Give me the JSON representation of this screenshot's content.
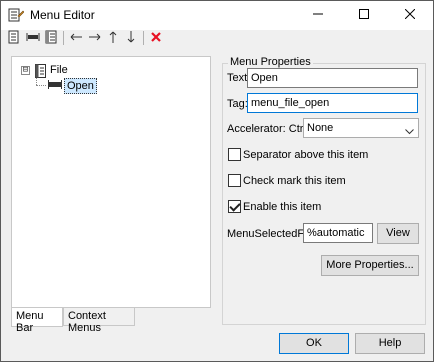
{
  "window": {
    "title": "Menu Editor"
  },
  "toolbar": {
    "icons": [
      "new-menu-icon",
      "new-menu-item-icon",
      "new-context-menu-icon",
      "move-left-icon",
      "move-right-icon",
      "move-up-icon",
      "move-down-icon",
      "delete-icon"
    ],
    "delete_color": "#e81123"
  },
  "tree": {
    "expander": "⊟",
    "items": [
      {
        "label": "File"
      },
      {
        "label": "Open"
      }
    ]
  },
  "tabs": [
    {
      "label": "Menu Bar"
    },
    {
      "label": "Context Menus"
    }
  ],
  "properties": {
    "title": "Menu Properties",
    "text_label": "Text:",
    "text_value": "Open",
    "tag_label": "Tag:",
    "tag_value": "menu_file_open",
    "accelerator_label": "Accelerator: Ctrl +",
    "accelerator_value": "None",
    "separator_label": "Separator above this item",
    "separator_checked": false,
    "checkmark_label": "Check mark this item",
    "checkmark_checked": false,
    "enable_label": "Enable this item",
    "enable_checked": true,
    "callback_label": "MenuSelectedFcn:",
    "callback_value": "%automatic",
    "view_button": "View",
    "more_button": "More Properties..."
  },
  "footer": {
    "ok_button": "OK",
    "help_button": "Help"
  },
  "colors": {
    "selection": "#cde8ff",
    "focus_border": "#0078d7"
  }
}
